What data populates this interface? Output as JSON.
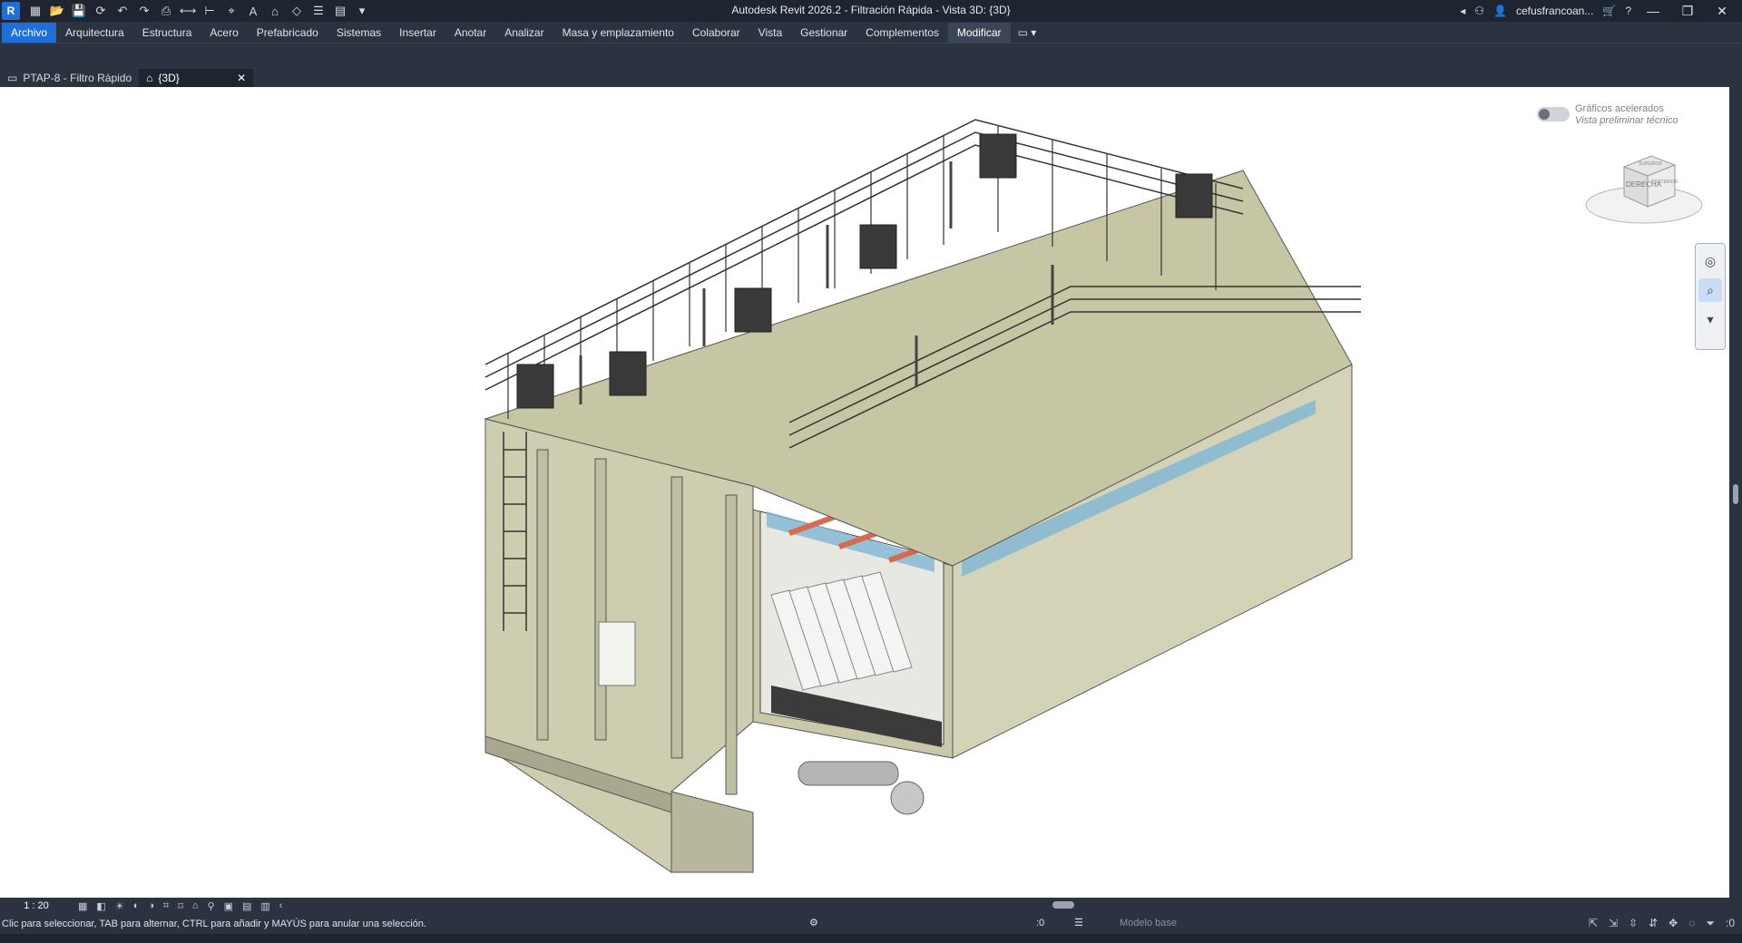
{
  "titlebar": {
    "logo": "R",
    "title": "Autodesk Revit 2026.2 - Filtración Rápida - Vista 3D: {3D}",
    "user": "cefusfrancoan...",
    "quick_access_icons": [
      "open-icon",
      "save-icon",
      "sync-icon",
      "undo-icon",
      "redo-icon",
      "print-icon",
      "measure-icon",
      "dimension-icon",
      "tag-icon",
      "text-icon",
      "3d-view-icon",
      "section-icon",
      "thin-lines-icon",
      "close-hidden-icon",
      "switch-windows-icon",
      "customize-icon"
    ],
    "window_buttons": [
      "—",
      "❐",
      "✕"
    ]
  },
  "ribbon": {
    "tabs": [
      "Archivo",
      "Arquitectura",
      "Estructura",
      "Acero",
      "Prefabricado",
      "Sistemas",
      "Insertar",
      "Anotar",
      "Analizar",
      "Masa y emplazamiento",
      "Colaborar",
      "Vista",
      "Gestionar",
      "Complementos",
      "Modificar"
    ],
    "active_tab": "Modificar",
    "extra_icon": "▭ ▾"
  },
  "viewtabs": [
    {
      "label": "PTAP-8 - Filtro Rápido",
      "icon": "plan-icon"
    },
    {
      "label": "{3D}",
      "icon": "house-icon",
      "active": true
    }
  ],
  "viewport": {
    "accelerated_graphics": "Gráficos acelerados",
    "technical_preview": "Vista preliminar técnico",
    "viewcube_face": "DERECHA",
    "viewcube_top": "SUPERIOR",
    "viewcube_back": "POSTERIOR"
  },
  "view_control": {
    "scale": "1 : 20"
  },
  "status": {
    "message": "Clic para seleccionar, TAB para alternar, CTRL para añadir y MAYÚS para anular una selección.",
    "workset_counter": ":0",
    "model": "Modelo base",
    "filter_counter": ":0"
  },
  "colors": {
    "chrome": "#2b3240",
    "title_bg": "#1f2530",
    "accent": "#1e6fd9",
    "concrete": "#c8c8a8",
    "water": "#7eb6d6",
    "pipe": "#d86a50"
  }
}
